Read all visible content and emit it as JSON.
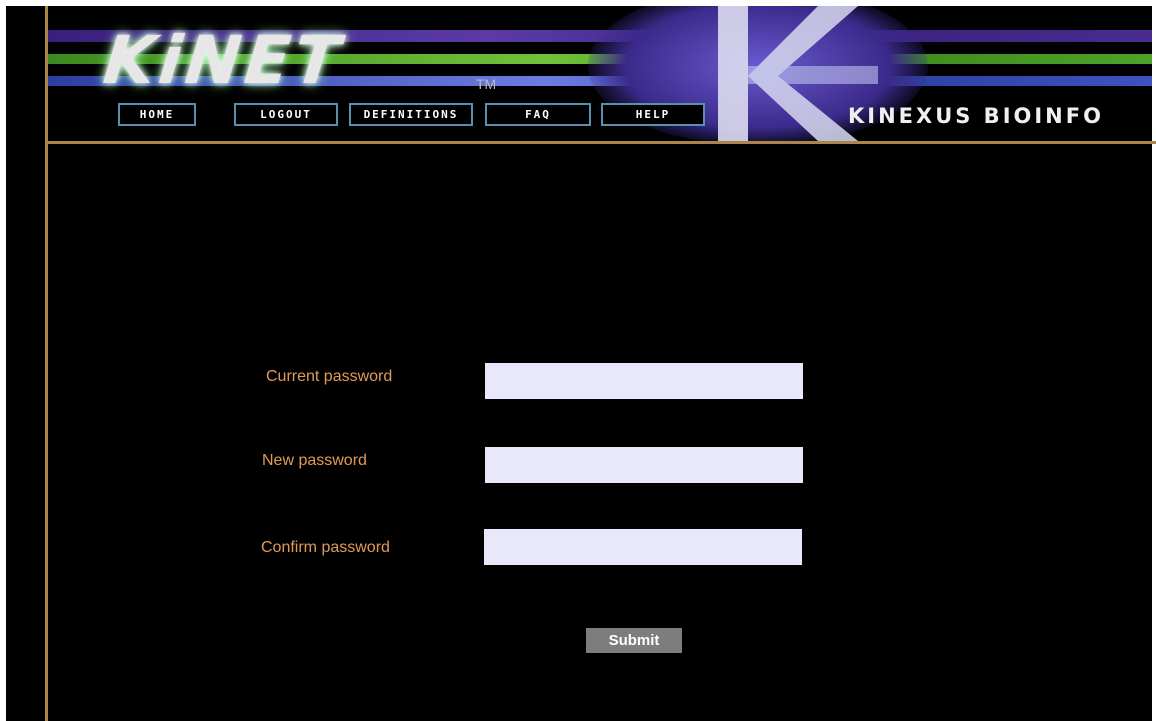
{
  "banner": {
    "logo": "KiNET",
    "trademark": "TM",
    "brand_text": "KINEXUS BIOINFO"
  },
  "nav": {
    "home": "HOME",
    "logout": "LOGOUT",
    "definitions": "DEFINITIONS",
    "faq": "FAQ",
    "help": "HELP"
  },
  "form": {
    "current_password_label": "Current password",
    "current_password_value": "",
    "new_password_label": "New password",
    "new_password_value": "",
    "confirm_password_label": "Confirm password",
    "confirm_password_value": "",
    "submit_label": "Submit"
  },
  "colors": {
    "background": "#000000",
    "label": "#e09a55",
    "field_bg": "#e8e8fa",
    "nav_border": "#5a8fb0",
    "divider": "#a9874a",
    "submit_bg": "#7d7d7d"
  }
}
